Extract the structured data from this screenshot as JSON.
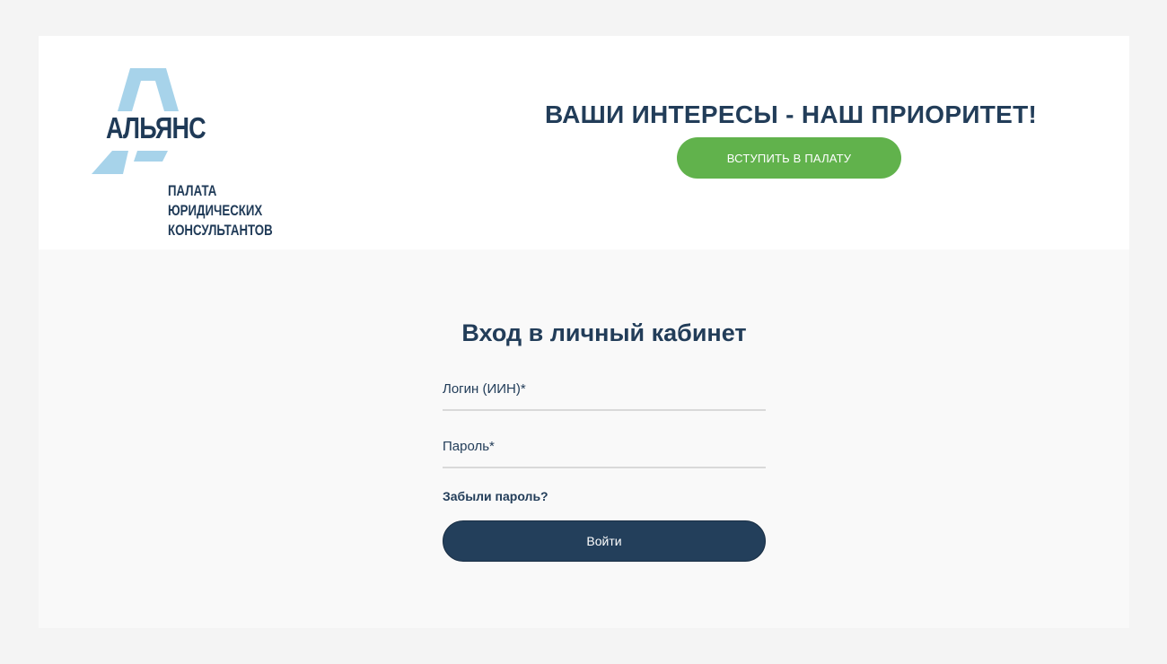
{
  "header": {
    "logo": {
      "name": "АЛЬЯНС",
      "subtitle_lines": [
        "ПАЛАТА",
        "ЮРИДИЧЕСКИХ",
        "КОНСУЛЬТАНТОВ"
      ],
      "icon": "alliance-a-logo-icon"
    },
    "slogan": "ВАШИ ИНТЕРЕСЫ - НАШ ПРИОРИТЕТ!",
    "join_button_label": "ВСТУПИТЬ В ПАЛАТУ"
  },
  "login": {
    "title": "Вход в личный кабинет",
    "login_label": "Логин (ИИН)*",
    "login_value": "",
    "password_label": "Пароль*",
    "password_value": "",
    "forgot_label": "Забыли пароль?",
    "submit_label": "Войти"
  },
  "colors": {
    "page_bg": "#f4f4f4",
    "header_bg": "#ffffff",
    "content_bg": "#f9f9f9",
    "primary_text": "#223d59",
    "join_button": "#61b24c",
    "submit_button": "#233f5b",
    "logo_accent": "#a7d3ea"
  }
}
